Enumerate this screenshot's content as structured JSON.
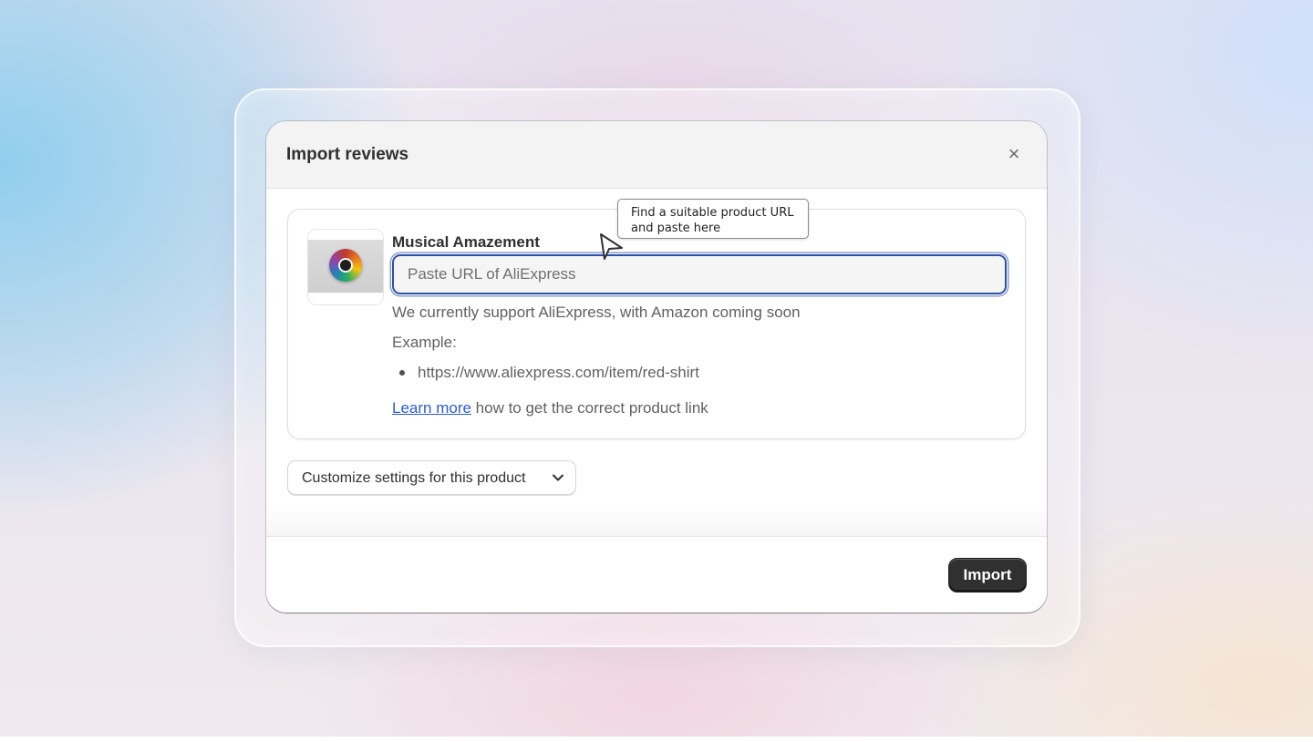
{
  "modal": {
    "title": "Import reviews",
    "close_glyph": "×"
  },
  "product": {
    "name": "Musical Amazement",
    "thumbnail_icon": "cd-disc-icon"
  },
  "url_input": {
    "value": "",
    "placeholder": "Paste URL of AliExpress"
  },
  "help": {
    "support_text": "We currently support AliExpress, with Amazon coming soon",
    "example_label": "Example:",
    "examples": [
      "https://www.aliexpress.com/item/red-shirt"
    ],
    "learn_more_link": "Learn more",
    "learn_more_rest": " how to get the correct product link"
  },
  "settings": {
    "customize_label": "Customize settings for this product"
  },
  "footer": {
    "import_label": "Import"
  },
  "tooltip": {
    "line1": "Find a suitable product URL",
    "line2": "and paste here"
  },
  "colors": {
    "focus_ring": "#2c4fa8",
    "link": "#2a5bd7",
    "primary_button": "#303030"
  }
}
